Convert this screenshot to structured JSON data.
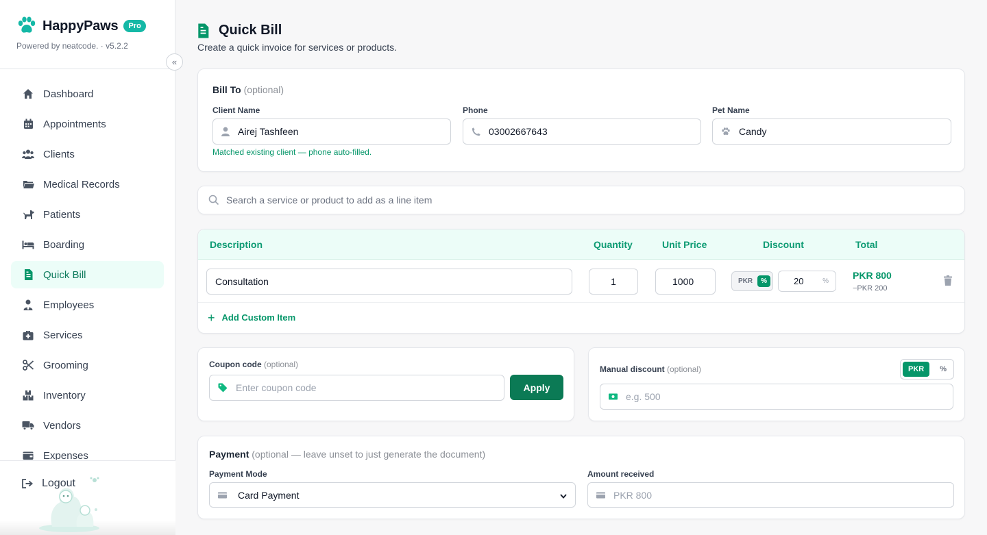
{
  "app": {
    "name": "HappyPaws",
    "badge": "Pro",
    "powered_by": "Powered by neatcode. · v5.2.2"
  },
  "colors": {
    "accent": "#059669",
    "accent_dark": "#0b7a55",
    "accent_light": "#ecfdf8",
    "brand_teal": "#14b8a6"
  },
  "sidebar": {
    "items": [
      {
        "label": "Dashboard",
        "icon": "home-icon"
      },
      {
        "label": "Appointments",
        "icon": "calendar-icon"
      },
      {
        "label": "Clients",
        "icon": "users-icon"
      },
      {
        "label": "Medical Records",
        "icon": "folder-icon"
      },
      {
        "label": "Patients",
        "icon": "dog-icon"
      },
      {
        "label": "Boarding",
        "icon": "bed-icon"
      },
      {
        "label": "Quick Bill",
        "icon": "file-invoice-icon",
        "active": true
      },
      {
        "label": "Employees",
        "icon": "user-tie-icon"
      },
      {
        "label": "Services",
        "icon": "medkit-icon"
      },
      {
        "label": "Grooming",
        "icon": "scissors-icon"
      },
      {
        "label": "Inventory",
        "icon": "boxes-icon"
      },
      {
        "label": "Vendors",
        "icon": "truck-icon"
      },
      {
        "label": "Expenses",
        "icon": "wallet-icon"
      }
    ],
    "logout_label": "Logout"
  },
  "page": {
    "title": "Quick Bill",
    "subtitle": "Create a quick invoice for services or products."
  },
  "bill_to": {
    "heading": "Bill To",
    "optional": "(optional)",
    "client_label": "Client Name",
    "client_value": "Airej Tashfeen",
    "phone_label": "Phone",
    "phone_value": "03002667643",
    "pet_label": "Pet Name",
    "pet_value": "Candy",
    "match_message": "Matched existing client — phone auto-filled."
  },
  "search": {
    "placeholder": "Search a service or product to add as a line item"
  },
  "items_table": {
    "headers": {
      "description": "Description",
      "quantity": "Quantity",
      "unit_price": "Unit Price",
      "discount": "Discount",
      "total": "Total"
    },
    "rows": [
      {
        "description": "Consultation",
        "quantity": "1",
        "unit_price": "1000",
        "discount_mode_pkr": "PKR",
        "discount_mode_pct": "%",
        "discount_mode_selected": "%",
        "discount_value": "20",
        "discount_suffix": "%",
        "total": "PKR 800",
        "savings": "−PKR 200"
      }
    ],
    "add_custom_label": "Add Custom Item"
  },
  "coupon": {
    "label": "Coupon code",
    "optional": "(optional)",
    "placeholder": "Enter coupon code",
    "apply_label": "Apply"
  },
  "manual_discount": {
    "label": "Manual discount",
    "optional": "(optional)",
    "mode_pkr": "PKR",
    "mode_pct": "%",
    "mode_selected": "PKR",
    "placeholder": "e.g. 500"
  },
  "payment": {
    "heading": "Payment",
    "optional": "(optional — leave unset to just generate the document)",
    "mode_label": "Payment Mode",
    "mode_value": "Card Payment",
    "amount_label": "Amount received",
    "amount_placeholder": "PKR 800"
  }
}
